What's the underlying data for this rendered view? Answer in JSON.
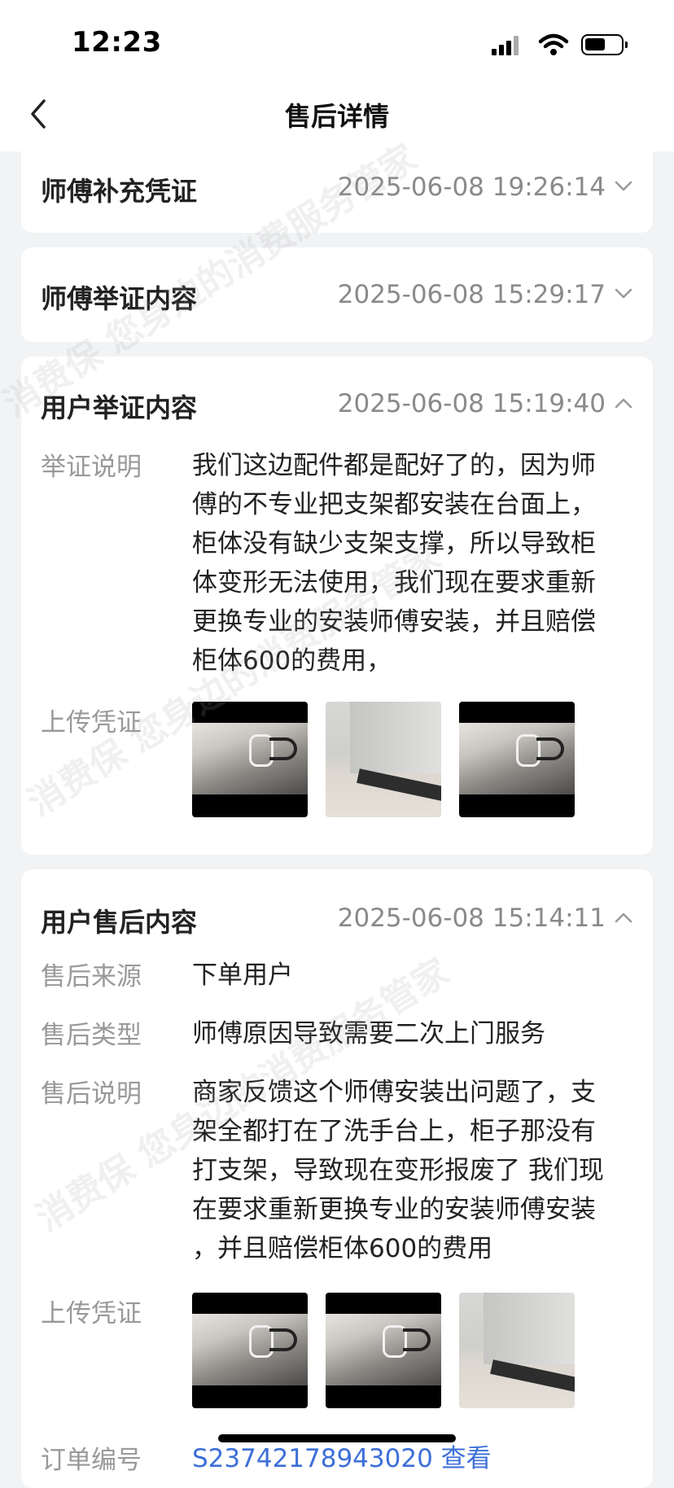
{
  "status_bar": {
    "time": "12:23"
  },
  "nav": {
    "title": "售后详情"
  },
  "cards": {
    "master_supplement": {
      "title": "师傅补充凭证",
      "time": "2025-06-08 19:26:14"
    },
    "master_evidence": {
      "title": "师傅举证内容",
      "time": "2025-06-08 15:29:17"
    },
    "user_evidence": {
      "title": "用户举证内容",
      "time": "2025-06-08 15:19:40",
      "desc_label": "举证说明",
      "desc_lines": [
        "我们这边配件都是配好了的，因为师",
        "傅的不专业把支架都安装在台面上，",
        "柜体没有缺少支架支撑，所以导致柜",
        "体变形无法使用，我们现在要求重新",
        "更换专业的安装师傅安装，并且赔偿",
        "柜体600的费用，"
      ],
      "upload_label": "上传凭证"
    },
    "user_aftersale": {
      "title": "用户售后内容",
      "time": "2025-06-08 15:14:11",
      "source_label": "售后来源",
      "source_value": "下单用户",
      "type_label": "售后类型",
      "type_value": "师傅原因导致需要二次上门服务",
      "desc_label": "售后说明",
      "desc_lines": [
        "商家反馈这个师傅安装出问题了，支",
        "架全都打在了洗手台上，柜子那没有",
        "打支架，导致现在变形报废了 我们现",
        "在要求重新更换专业的安装师傅安装",
        "，并且赔偿柜体600的费用"
      ],
      "upload_label": "上传凭证",
      "order_label": "订单编号",
      "order_value": "S23742178943020 查看"
    }
  },
  "watermark": "消费保 您身边的消费服务管家",
  "icons": {
    "back": "chevron-left-icon",
    "collapse": "chevron-down-icon",
    "expand": "chevron-up-icon"
  }
}
